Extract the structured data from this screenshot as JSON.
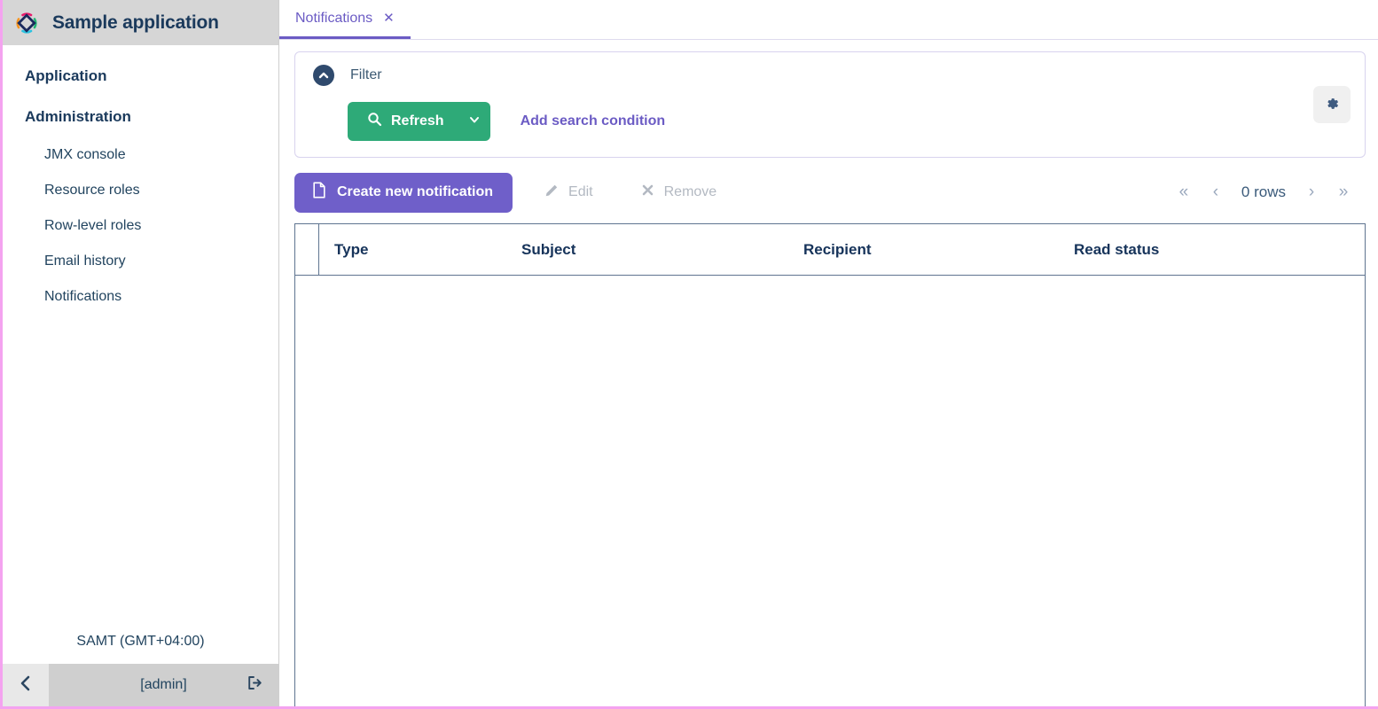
{
  "sidebar": {
    "app_title": "Sample application",
    "logo_icon": "diamond-logo-icon",
    "sections": [
      {
        "label": "Application",
        "items": []
      },
      {
        "label": "Administration",
        "items": [
          {
            "label": "JMX console"
          },
          {
            "label": "Resource roles"
          },
          {
            "label": "Row-level roles"
          },
          {
            "label": "Email history"
          },
          {
            "label": "Notifications"
          }
        ]
      }
    ],
    "timezone": "SAMT (GMT+04:00)",
    "collapse_icon": "chevron-left-icon",
    "user_name": "[admin]",
    "logout_icon": "logout-icon"
  },
  "tabs": [
    {
      "label": "Notifications",
      "close_icon": "close-icon",
      "active": true
    }
  ],
  "filter": {
    "toggle_icon": "chevron-up-circle-icon",
    "label": "Filter",
    "refresh_label": "Refresh",
    "refresh_icon": "search-icon",
    "refresh_caret_icon": "chevron-down-icon",
    "add_condition_label": "Add search condition",
    "settings_icon": "gear-icon"
  },
  "toolbar": {
    "create_label": "Create new notification",
    "create_icon": "file-icon",
    "edit_label": "Edit",
    "edit_icon": "pencil-icon",
    "remove_label": "Remove",
    "remove_icon": "cross-icon"
  },
  "pagination": {
    "first_icon": "«",
    "prev_icon": "‹",
    "rows_label": "0 rows",
    "next_icon": "›",
    "last_icon": "»"
  },
  "table": {
    "columns": [
      "Type",
      "Subject",
      "Recipient",
      "Read status"
    ],
    "rows": []
  },
  "colors": {
    "accent_purple": "#6b5bc4",
    "create_purple": "#6f5fc9",
    "refresh_green": "#2eaa78",
    "border_pink": "#f4a3f0",
    "table_border": "#5f7490",
    "heading_navy": "#16335a",
    "sidebar_header_bg": "#d6d6d6"
  }
}
